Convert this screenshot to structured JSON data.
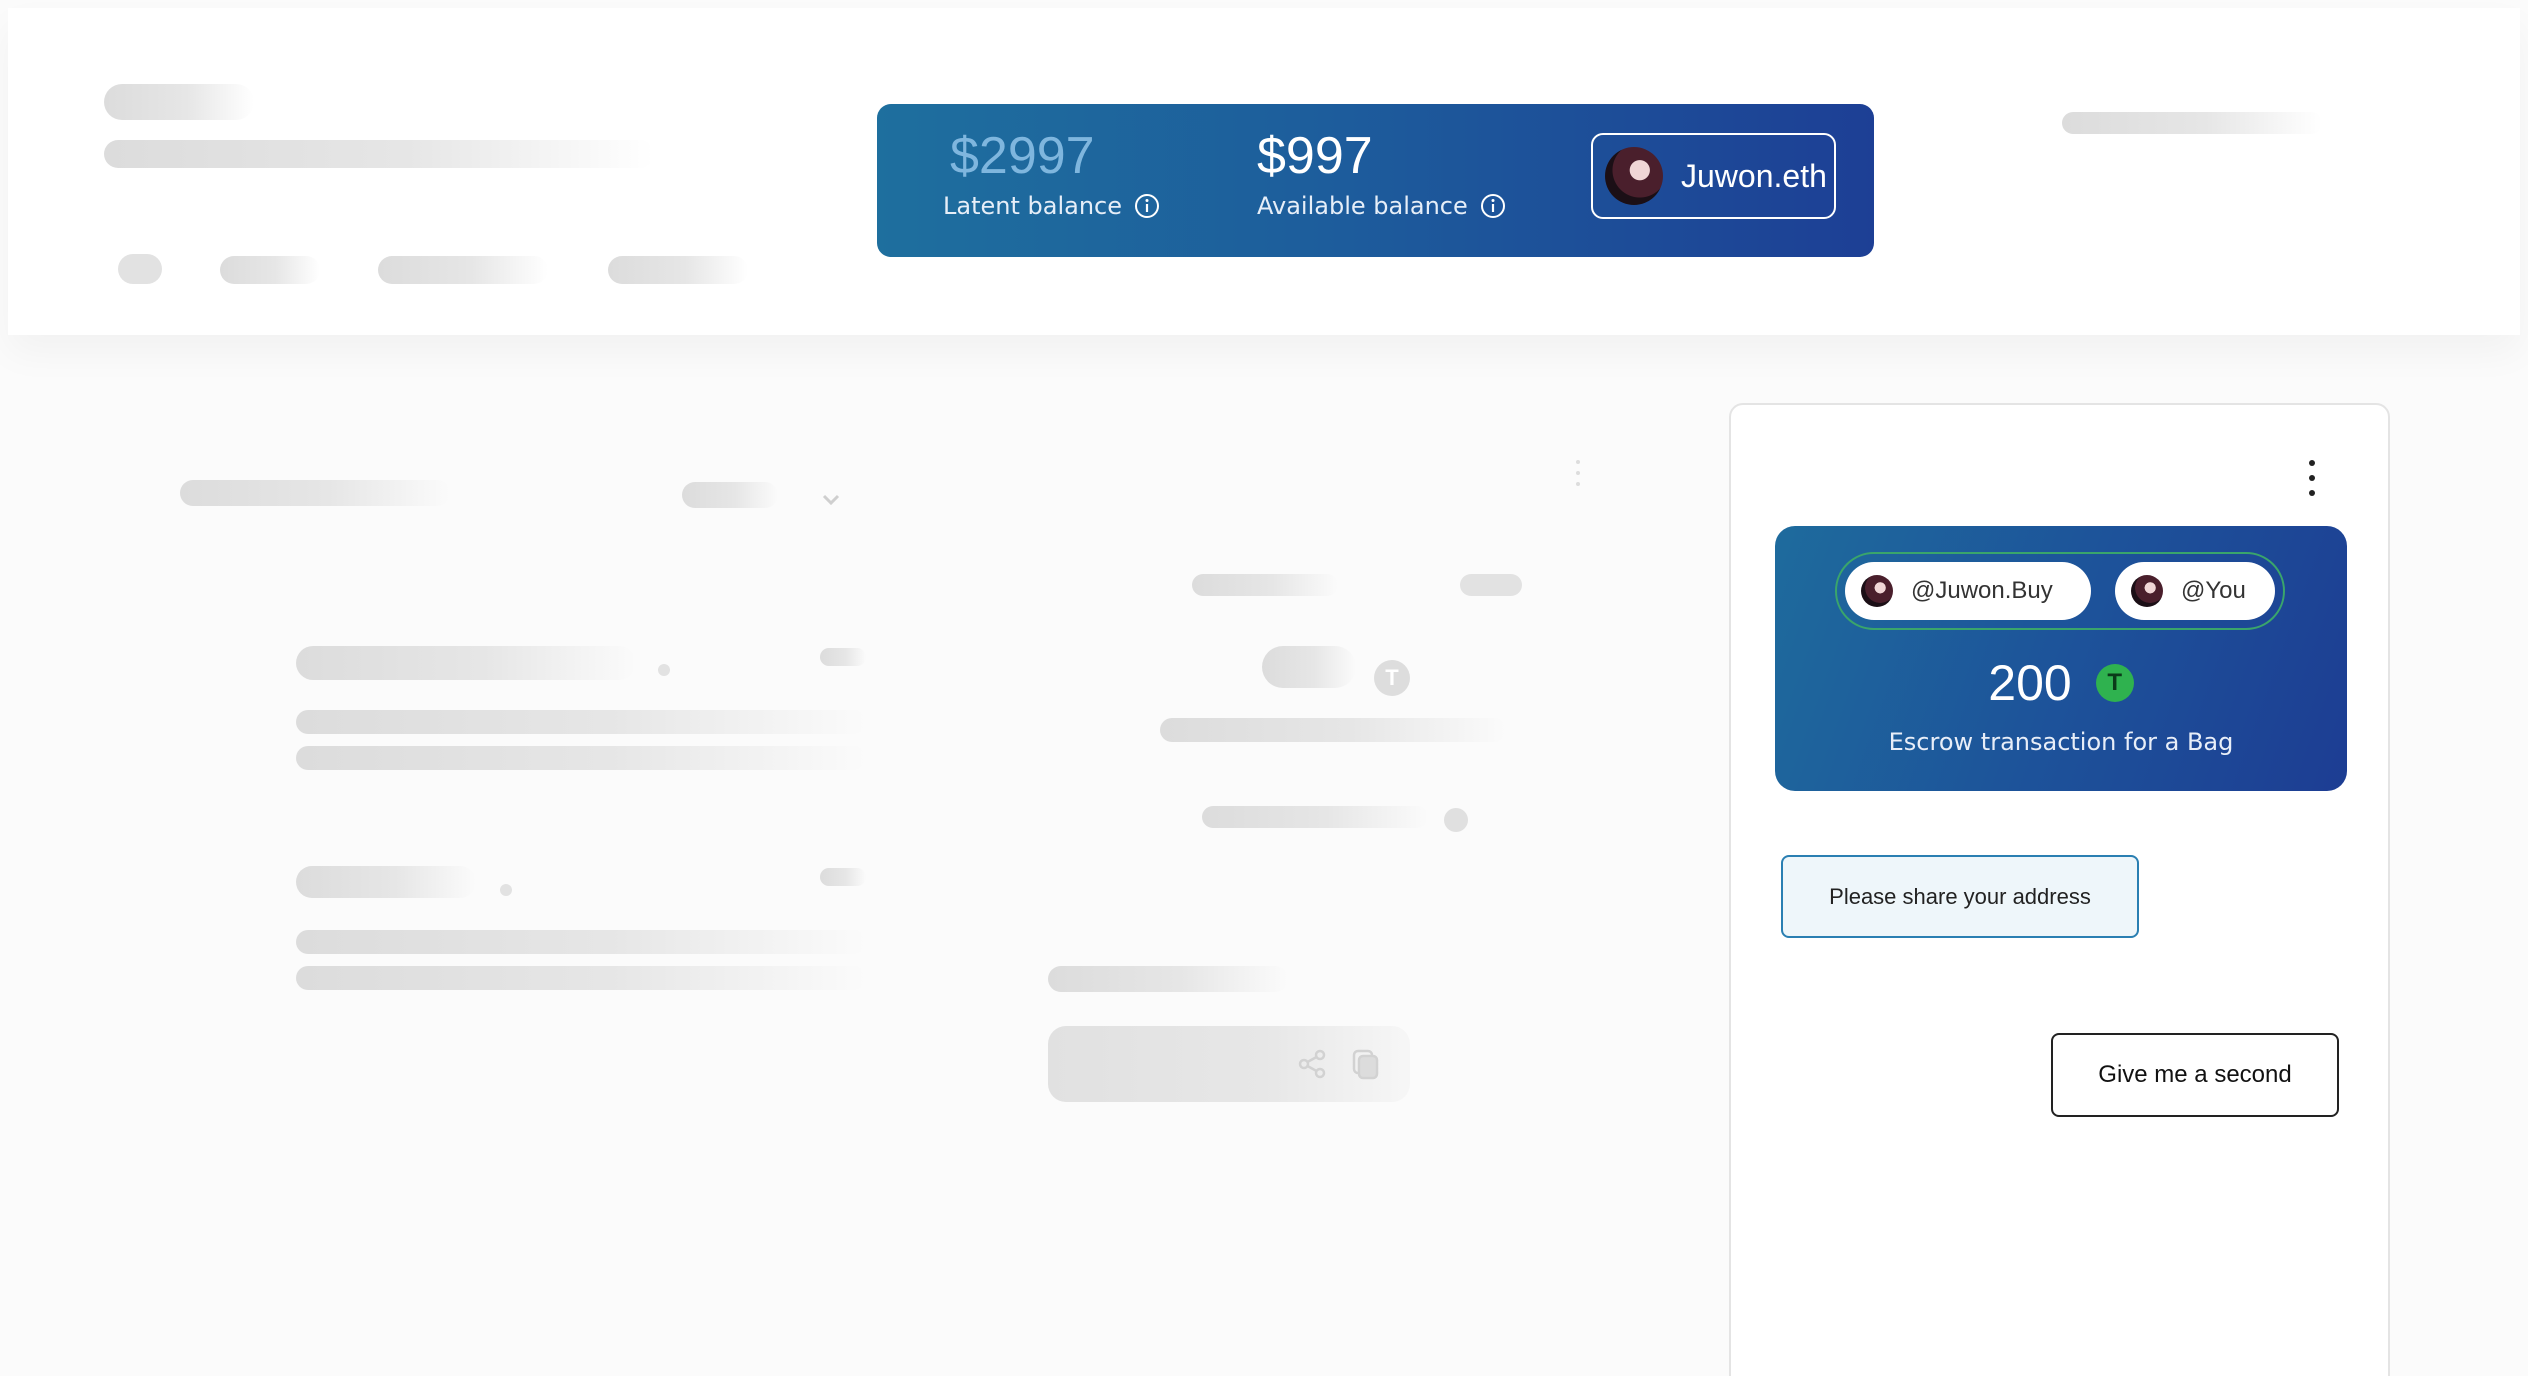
{
  "balance": {
    "latent_amount": "$2997",
    "latent_label": "Latent balance",
    "available_amount": "$997",
    "available_label": "Available balance",
    "user_name": "Juwon.eth"
  },
  "chat": {
    "escrow": {
      "buyer": "@Juwon.Buy",
      "seller": "@You",
      "amount": "200",
      "currency_icon": "tether-icon",
      "description": "Escrow transaction for a Bag"
    },
    "message": "Please share your address",
    "reply_button": "Give me a second"
  },
  "colors": {
    "card_gradient_start": "#1e6f9e",
    "card_gradient_end": "#1d3f95",
    "tether_green": "#2fb24f",
    "message_border": "#2a7fb2"
  }
}
